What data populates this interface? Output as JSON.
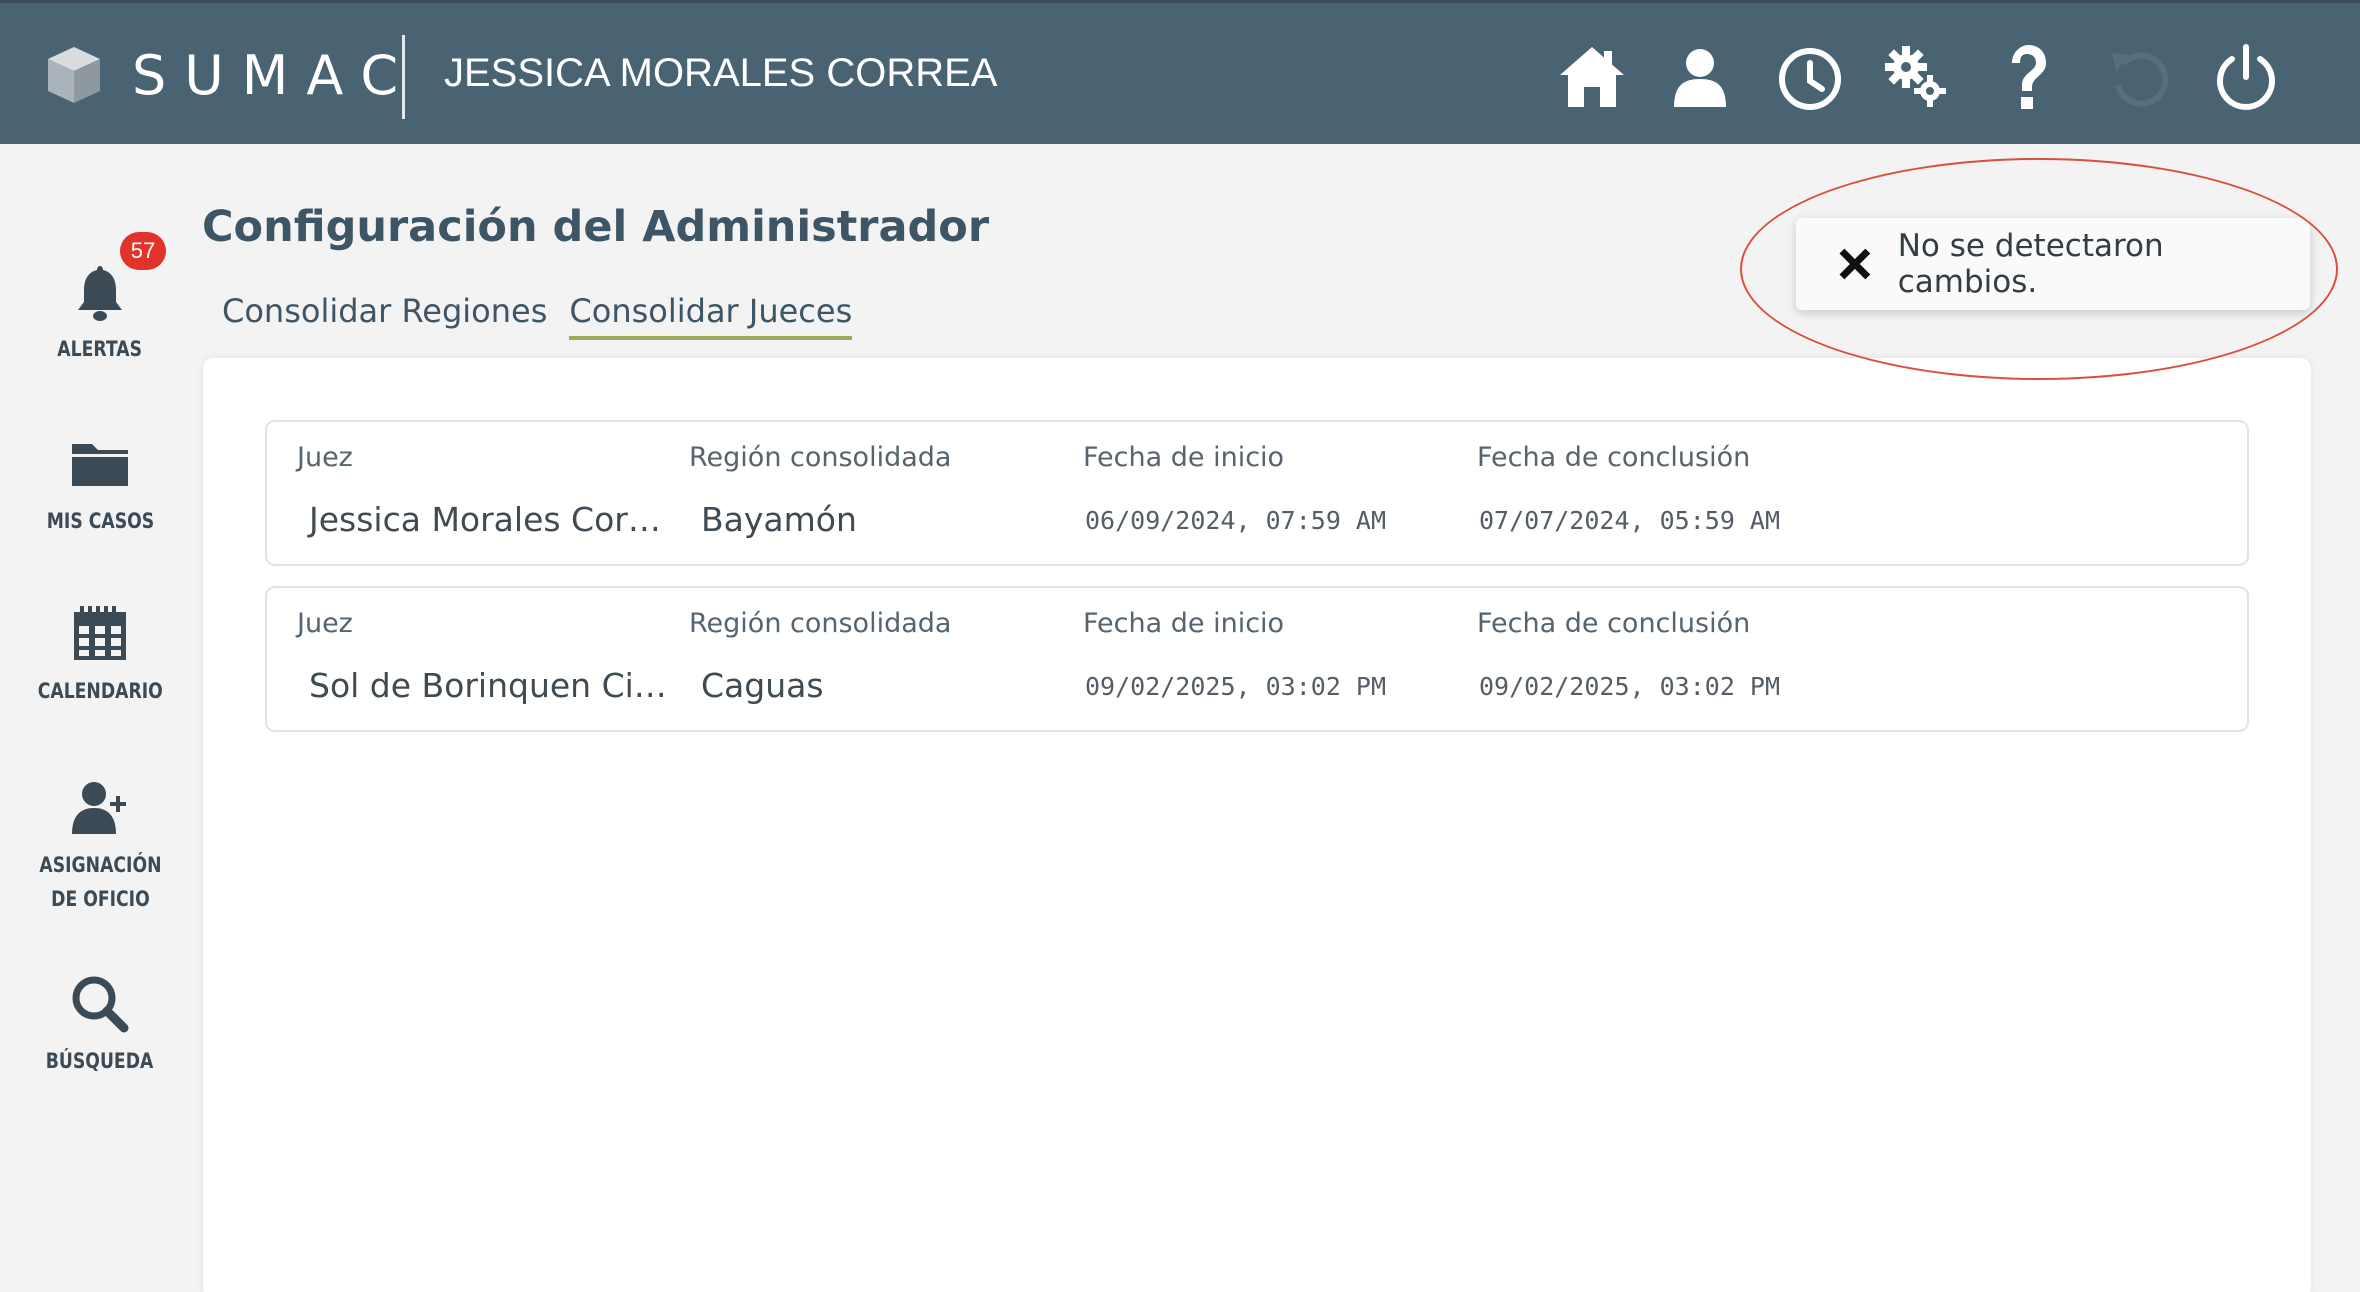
{
  "header": {
    "logo_text": "SUMAC",
    "user_name": "JESSICA MORALES CORREA",
    "icons": [
      "home-icon",
      "user-icon",
      "clock-icon",
      "gears-icon",
      "help-icon",
      "undo-icon",
      "power-icon"
    ]
  },
  "sidebar": {
    "items": [
      {
        "label": "ALERTAS",
        "icon": "bell-icon",
        "badge": "57"
      },
      {
        "label": "MIS CASOS",
        "icon": "folder-icon"
      },
      {
        "label": "CALENDARIO",
        "icon": "calendar-icon"
      },
      {
        "label_line1": "ASIGNACIÓN",
        "label_line2": "DE OFICIO",
        "icon": "user-plus-icon"
      },
      {
        "label": "BÚSQUEDA",
        "icon": "search-icon"
      }
    ]
  },
  "main": {
    "title": "Configuración del Administrador",
    "tabs": [
      {
        "label": "Consolidar Regiones",
        "active": false
      },
      {
        "label": "Consolidar Jueces",
        "active": true
      }
    ],
    "columns": {
      "judge": "Juez",
      "region": "Región consolidada",
      "start": "Fecha de inicio",
      "end": "Fecha de conclusión"
    },
    "rows": [
      {
        "judge": "Jessica Morales Cor…",
        "region": "Bayamón",
        "start": "06/09/2024, 07:59 AM",
        "end": "07/07/2024, 05:59 AM"
      },
      {
        "judge": "Sol de Borinquen Ci…",
        "region": "Caguas",
        "start": "09/02/2025, 03:02 PM",
        "end": "09/02/2025, 03:02 PM"
      }
    ]
  },
  "toast": {
    "message": "No se detectaron cambios.",
    "icon": "close-icon"
  },
  "colors": {
    "header_bg": "#4a6373",
    "tab_underline": "#9aab55",
    "badge": "#e2332b",
    "annotation": "#d9503e"
  }
}
